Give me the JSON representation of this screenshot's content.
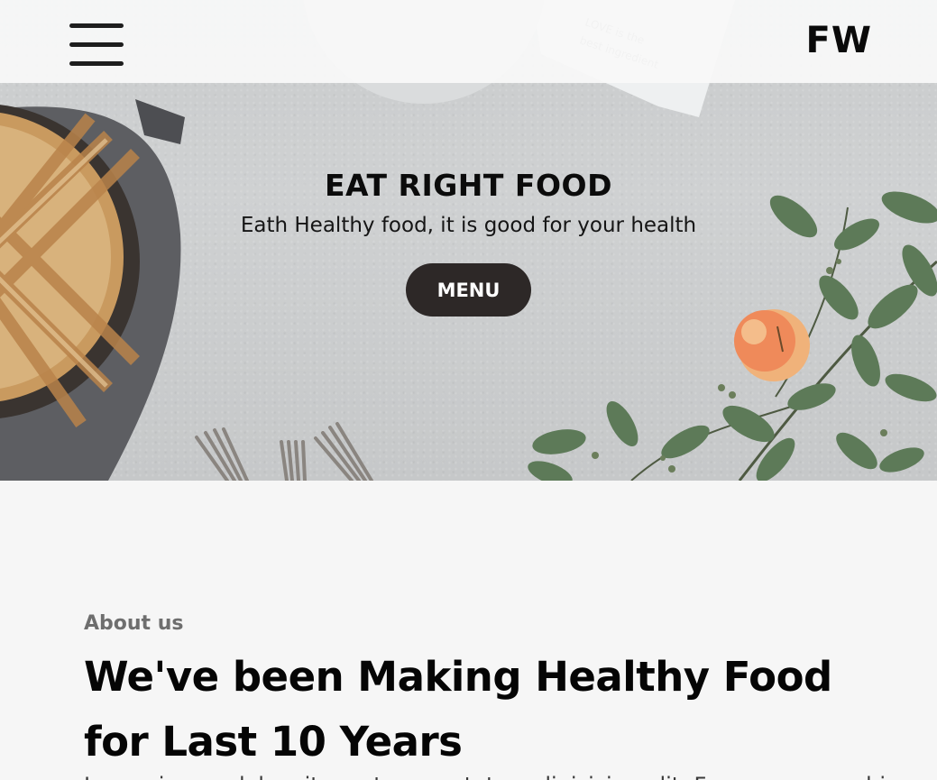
{
  "header": {
    "menu_icon": "hamburger-menu-icon",
    "logo": "FW"
  },
  "hero": {
    "title": "EAT RIGHT FOOD",
    "subtitle": "Eath Healthy food, it is good for your health",
    "button_label": "MENU",
    "napkin_text": "LOVE is the best ingredient"
  },
  "about": {
    "label": "About us",
    "heading": "We've been Making Healthy Food for Last 10 Years",
    "body": "Lorem ipsum dolor sit amet consectetur adipisicing elit. Facere cumque hic"
  },
  "colors": {
    "topbar_bg": "#f9f9f9",
    "button_bg": "#2d2827",
    "button_text": "#ffffff",
    "page_bg": "#f6f6f6",
    "label_gray": "#6e6e6e"
  }
}
